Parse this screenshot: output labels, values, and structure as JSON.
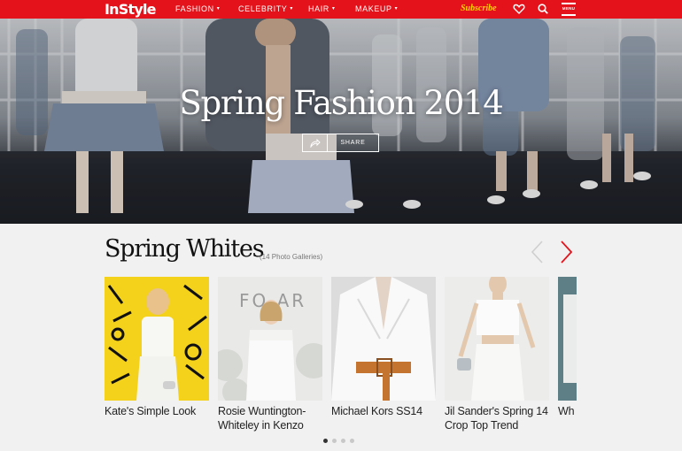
{
  "brand": {
    "logo": "InStyle",
    "accent": "#e4131b",
    "subscribe_color": "#ffd400"
  },
  "nav": {
    "items": [
      {
        "label": "FASHION",
        "caret": "▾"
      },
      {
        "label": "CELEBRITY",
        "caret": "▾"
      },
      {
        "label": "HAIR",
        "caret": "▾"
      },
      {
        "label": "MAKEUP",
        "caret": "▾"
      }
    ],
    "subscribe": "Subscribe",
    "menu_label": "MENU",
    "icons": [
      "heart-icon",
      "search-icon",
      "hamburger-menu-icon"
    ]
  },
  "hero": {
    "title": "Spring Fashion 2014",
    "share_label": "SHARE",
    "share_icon": "share-arrow-icon"
  },
  "section": {
    "title": "Spring Whites",
    "count": "(14 Photo Galleries)",
    "cards": [
      {
        "caption": "Kate's Simple Look"
      },
      {
        "caption": "Rosie Wuntington-Whiteley in Kenzo"
      },
      {
        "caption": "Michael Kors SS14"
      },
      {
        "caption": "Jil Sander's Spring 14 Crop Top Trend"
      },
      {
        "caption": "Wh"
      }
    ],
    "pager": {
      "total": 4,
      "active": 1
    }
  }
}
